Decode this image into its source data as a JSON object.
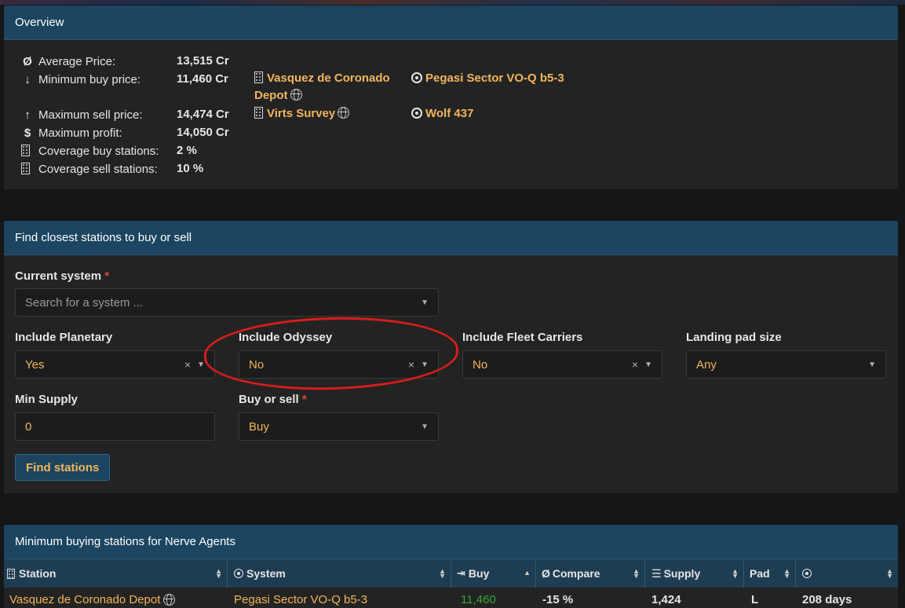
{
  "overview": {
    "title": "Overview",
    "stats": [
      {
        "icon": "average-icon",
        "glyph": "Ø",
        "label": "Average Price:",
        "value": "13,515 Cr"
      },
      {
        "icon": "arrow-down-icon",
        "glyph": "↓",
        "label": "Minimum buy price:",
        "value": "11,460 Cr"
      },
      {
        "icon": "arrow-up-icon",
        "glyph": "↑",
        "label": "Maximum sell price:",
        "value": "14,474 Cr"
      },
      {
        "icon": "dollar-icon",
        "glyph": "$",
        "label": "Maximum profit:",
        "value": "14,050 Cr"
      },
      {
        "icon": "building-icon",
        "glyph": "",
        "label": "Coverage buy stations:",
        "value": "2 %"
      },
      {
        "icon": "building-icon",
        "glyph": "",
        "label": "Coverage sell stations:",
        "value": "10 %"
      }
    ],
    "min_buy_station_line1": "Vasquez de Coronado",
    "min_buy_station_line2": "Depot",
    "min_buy_system": "Pegasi Sector VO-Q b5-3",
    "max_sell_station": "Virts Survey",
    "max_sell_system": "Wolf 437"
  },
  "finder": {
    "title": "Find closest stations to buy or sell",
    "current_system_label": "Current system",
    "required_mark": "*",
    "current_system_placeholder": "Search for a system ...",
    "include_planetary_label": "Include Planetary",
    "include_planetary_value": "Yes",
    "include_odyssey_label": "Include Odyssey",
    "include_odyssey_value": "No",
    "include_fleet_label": "Include Fleet Carriers",
    "include_fleet_value": "No",
    "landing_pad_label": "Landing pad size",
    "landing_pad_value": "Any",
    "min_supply_label": "Min Supply",
    "min_supply_value": "0",
    "buy_sell_label": "Buy or sell",
    "buy_sell_value": "Buy",
    "find_button": "Find stations",
    "clear_glyph": "×",
    "caret_glyph": "▼"
  },
  "results": {
    "title": "Minimum buying stations for Nerve Agents",
    "columns": [
      {
        "label": "Station",
        "icon": "building-icon"
      },
      {
        "label": "System",
        "icon": "target-icon"
      },
      {
        "label": "Buy",
        "icon": "sign-in-icon"
      },
      {
        "label": "Compare",
        "icon": "average-icon"
      },
      {
        "label": "Supply",
        "icon": "list-icon"
      },
      {
        "label": "Pad",
        "icon": ""
      },
      {
        "label": "",
        "icon": "clock-icon"
      }
    ],
    "rows": [
      {
        "station": "Vasquez de Coronado Depot",
        "system": "Pegasi Sector VO-Q b5-3",
        "buy": "11,460",
        "compare": "-15 %",
        "supply": "1,424",
        "pad": "L",
        "age": "208 days"
      }
    ],
    "colors": {
      "buy": "#3aa43a",
      "link": "#f2b55c"
    }
  }
}
